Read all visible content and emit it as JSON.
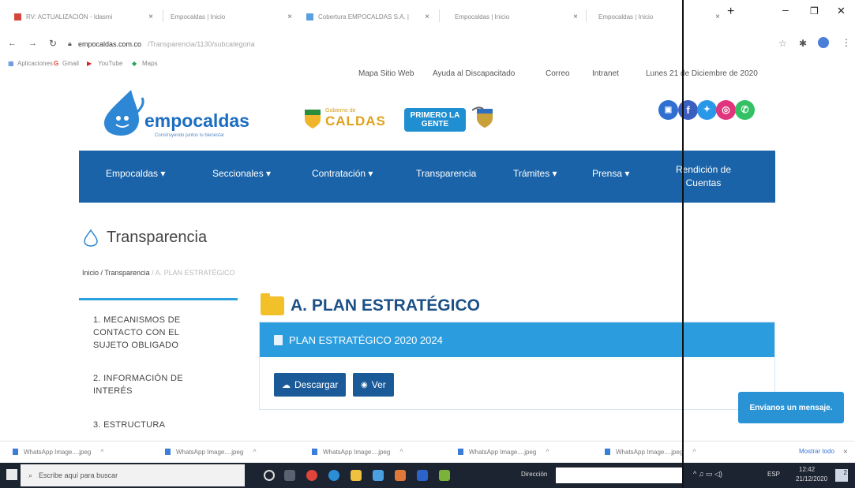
{
  "browser": {
    "tabs": [
      "RV: ACTUALIZACIÓN - Idasmi",
      "Empocaldas | Inicio",
      "Cobertura EMPOCALDAS S.A. |",
      "Empocaldas | Inicio",
      "Empocaldas | Inicio"
    ],
    "new_tab": "+",
    "address_host": "empocaldas.com.co",
    "address_path": "/Transparencia/1130/subcategoria",
    "bookmarks": [
      "Aplicaciones",
      "Gmail",
      "YouTube",
      "Maps"
    ]
  },
  "site": {
    "top_links": [
      "Mapa Sitio Web",
      "Ayuda al Discapacitado",
      "Correo",
      "Intranet"
    ],
    "date": "Lunes 21 de Diciembre de 2020",
    "logo": "empocaldas",
    "tagline": "Construyendo juntos tu bienestar",
    "gob_small": "Gobierno de",
    "gob_big": "CALDAS",
    "primero": "PRIMERO LA GENTE",
    "nav": [
      "Empocaldas ▾",
      "Seccionales ▾",
      "Contratación ▾",
      "Transparencia",
      "Trámites ▾",
      "Prensa ▾",
      "Rendición de Cuentas"
    ],
    "section_title": "Transparencia",
    "breadcrumb": {
      "home": "Inicio",
      "mid": "Transparencia",
      "current": "A. PLAN ESTRATÉGICO"
    },
    "sidebar": [
      "1. MECANISMOS DE CONTACTO CON EL SUJETO OBLIGADO",
      "2. INFORMACIÓN DE INTERÉS",
      "3. ESTRUCTURA"
    ],
    "heading": "A. PLAN ESTRATÉGICO",
    "panel_title": "PLAN ESTRATÉGICO 2020 2024",
    "btn_download": "Descargar",
    "btn_view": "Ver",
    "chat": "Envíanos un mensaje."
  },
  "downloads": {
    "items": [
      "WhatsApp Image....jpeg",
      "WhatsApp Image....jpeg",
      "WhatsApp Image....jpeg",
      "WhatsApp Image....jpeg",
      "WhatsApp Image....jpeg"
    ],
    "show_all": "Mostrar todo"
  },
  "taskbar": {
    "search": "Escribe aquí para buscar",
    "address_label": "Dirección",
    "lang": "ESP",
    "time": "12:42",
    "date": "21/12/2020",
    "notif_count": "2"
  }
}
